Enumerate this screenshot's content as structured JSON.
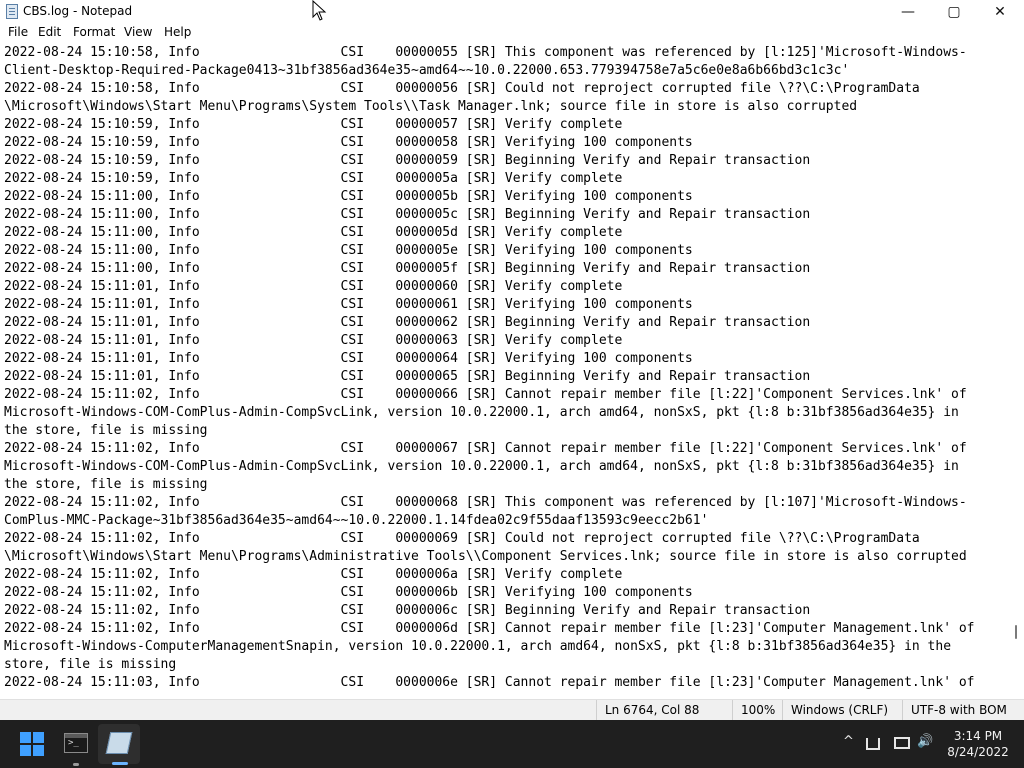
{
  "window": {
    "title": "CBS.log - Notepad",
    "minimize_glyph": "—",
    "maximize_glyph": "▢",
    "close_glyph": "✕"
  },
  "menu": [
    "File",
    "Edit",
    "Format",
    "View",
    "Help"
  ],
  "editor": {
    "lines": [
      "2022-08-24 15:10:58, Info                  CSI    00000055 [SR] This component was referenced by [l:125]'Microsoft-Windows-",
      "Client-Desktop-Required-Package0413~31bf3856ad364e35~amd64~~10.0.22000.653.779394758e7a5c6e0e8a6b66bd3c1c3c'",
      "2022-08-24 15:10:58, Info                  CSI    00000056 [SR] Could not reproject corrupted file \\??\\C:\\ProgramData",
      "\\Microsoft\\Windows\\Start Menu\\Programs\\System Tools\\\\Task Manager.lnk; source file in store is also corrupted",
      "2022-08-24 15:10:59, Info                  CSI    00000057 [SR] Verify complete",
      "2022-08-24 15:10:59, Info                  CSI    00000058 [SR] Verifying 100 components",
      "2022-08-24 15:10:59, Info                  CSI    00000059 [SR] Beginning Verify and Repair transaction",
      "2022-08-24 15:10:59, Info                  CSI    0000005a [SR] Verify complete",
      "2022-08-24 15:11:00, Info                  CSI    0000005b [SR] Verifying 100 components",
      "2022-08-24 15:11:00, Info                  CSI    0000005c [SR] Beginning Verify and Repair transaction",
      "2022-08-24 15:11:00, Info                  CSI    0000005d [SR] Verify complete",
      "2022-08-24 15:11:00, Info                  CSI    0000005e [SR] Verifying 100 components",
      "2022-08-24 15:11:00, Info                  CSI    0000005f [SR] Beginning Verify and Repair transaction",
      "2022-08-24 15:11:01, Info                  CSI    00000060 [SR] Verify complete",
      "2022-08-24 15:11:01, Info                  CSI    00000061 [SR] Verifying 100 components",
      "2022-08-24 15:11:01, Info                  CSI    00000062 [SR] Beginning Verify and Repair transaction",
      "2022-08-24 15:11:01, Info                  CSI    00000063 [SR] Verify complete",
      "2022-08-24 15:11:01, Info                  CSI    00000064 [SR] Verifying 100 components",
      "2022-08-24 15:11:01, Info                  CSI    00000065 [SR] Beginning Verify and Repair transaction",
      "2022-08-24 15:11:02, Info                  CSI    00000066 [SR] Cannot repair member file [l:22]'Component Services.lnk' of",
      "Microsoft-Windows-COM-ComPlus-Admin-CompSvcLink, version 10.0.22000.1, arch amd64, nonSxS, pkt {l:8 b:31bf3856ad364e35} in",
      "the store, file is missing",
      "2022-08-24 15:11:02, Info                  CSI    00000067 [SR] Cannot repair member file [l:22]'Component Services.lnk' of",
      "Microsoft-Windows-COM-ComPlus-Admin-CompSvcLink, version 10.0.22000.1, arch amd64, nonSxS, pkt {l:8 b:31bf3856ad364e35} in",
      "the store, file is missing",
      "2022-08-24 15:11:02, Info                  CSI    00000068 [SR] This component was referenced by [l:107]'Microsoft-Windows-",
      "ComPlus-MMC-Package~31bf3856ad364e35~amd64~~10.0.22000.1.14fdea02c9f55daaf13593c9eecc2b61'",
      "2022-08-24 15:11:02, Info                  CSI    00000069 [SR] Could not reproject corrupted file \\??\\C:\\ProgramData",
      "\\Microsoft\\Windows\\Start Menu\\Programs\\Administrative Tools\\\\Component Services.lnk; source file in store is also corrupted",
      "2022-08-24 15:11:02, Info                  CSI    0000006a [SR] Verify complete",
      "2022-08-24 15:11:02, Info                  CSI    0000006b [SR] Verifying 100 components",
      "2022-08-24 15:11:02, Info                  CSI    0000006c [SR] Beginning Verify and Repair transaction",
      "2022-08-24 15:11:02, Info                  CSI    0000006d [SR] Cannot repair member file [l:23]'Computer Management.lnk' of",
      "Microsoft-Windows-ComputerManagementSnapin, version 10.0.22000.1, arch amd64, nonSxS, pkt {l:8 b:31bf3856ad364e35} in the",
      "store, file is missing",
      "2022-08-24 15:11:03, Info                  CSI    0000006e [SR] Cannot repair member file [l:23]'Computer Management.lnk' of"
    ]
  },
  "statusbar": {
    "position": "Ln 6764, Col 88",
    "zoom": "100%",
    "line_endings": "Windows (CRLF)",
    "encoding": "UTF-8 with BOM"
  },
  "taskbar": {
    "apps": [
      "start-icon",
      "terminal-icon",
      "notepad-icon"
    ],
    "active_app": "notepad-icon",
    "tray_chevron": "^",
    "tray_volume": "🔊",
    "time": "3:14 PM",
    "date": "8/24/2022"
  }
}
